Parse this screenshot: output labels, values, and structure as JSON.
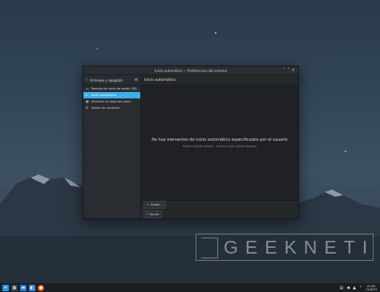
{
  "window": {
    "title": "Inicio automático — Preferencias del sistema",
    "controls": [
      "˅",
      "˄",
      "×"
    ]
  },
  "sidebar": {
    "header_title": "Arranque y apagado",
    "items": [
      {
        "label": "Pantalla de inicio de sesión (SD...",
        "icon": "monitor-icon",
        "active": false
      },
      {
        "label": "Inicio automático",
        "icon": "autostart-icon",
        "active": true
      },
      {
        "label": "Servicios en segundo plano",
        "icon": "services-icon",
        "active": false
      },
      {
        "label": "Sesión de escritorio",
        "icon": "session-icon",
        "active": false
      }
    ]
  },
  "main": {
    "header": "Inicio automático",
    "empty_title": "No hay elementos de inicio automático especificados por el usuario",
    "empty_hint": "Pulse el botón Añadir... inferior para añadir algunos",
    "add_button": "Añadir...",
    "help_button": "Ayuda"
  },
  "watermark": {
    "text": "GEEKNETIC"
  },
  "taskbar": {
    "apps": [
      "kde-launcher-icon",
      "pager-icon",
      "dolphin-icon",
      "discover-icon",
      "firefox-icon"
    ],
    "clock_time": "21:05",
    "clock_date": "11/4/23"
  },
  "colors": {
    "accent": "#3daee9",
    "window_bg": "#232629"
  }
}
